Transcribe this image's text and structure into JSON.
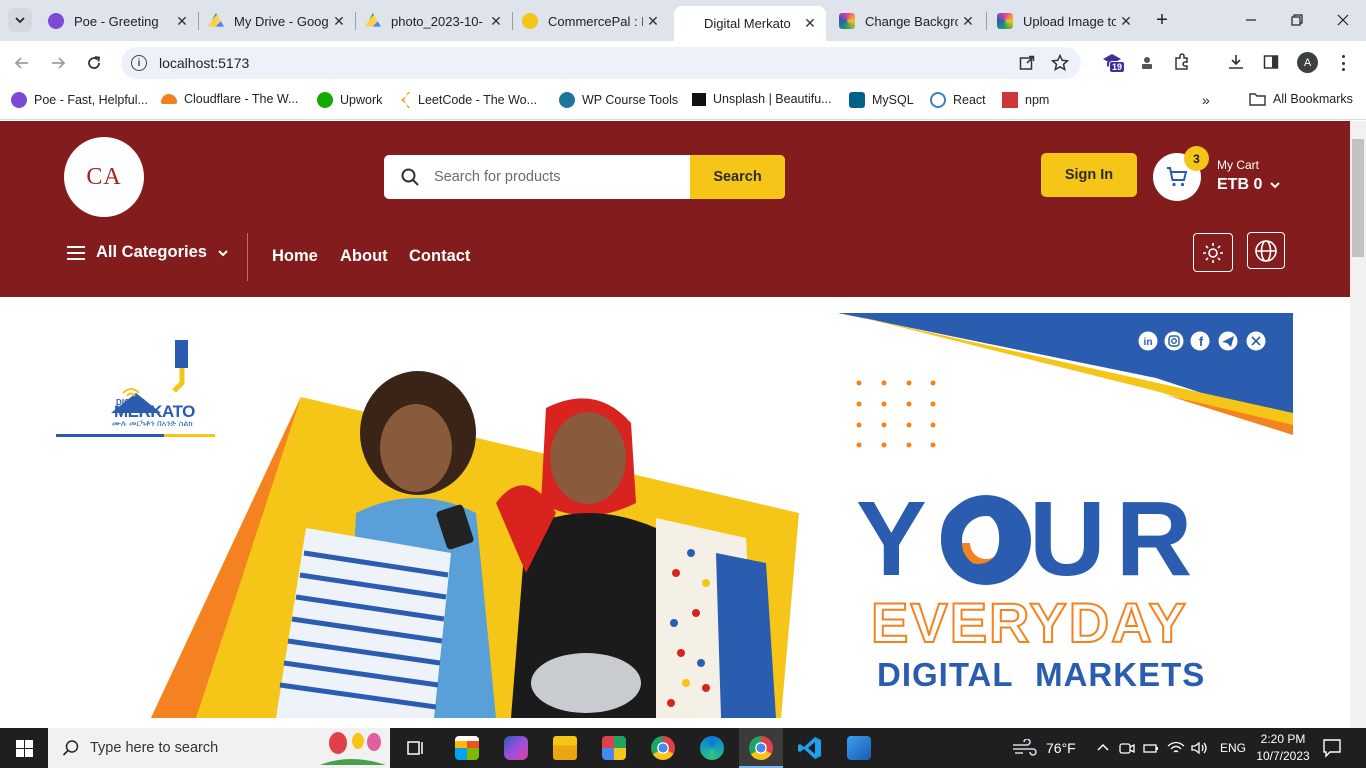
{
  "browser": {
    "tabs": [
      {
        "title": "Poe - Greeting",
        "color": "#7b4bd8"
      },
      {
        "title": "My Drive - Goog",
        "color": "#1fa463"
      },
      {
        "title": "photo_2023-10-",
        "color": "#1fa463"
      },
      {
        "title": "CommercePal : E",
        "color": "#f5c518"
      },
      {
        "title": "Digital Merkato",
        "color": "#ffffff"
      },
      {
        "title": "Change Backgro",
        "color": "#e040a0"
      },
      {
        "title": "Upload Image to",
        "color": "#e040a0"
      }
    ],
    "url": "localhost:5173",
    "extension_badge": "19",
    "profile_initial": "A",
    "bookmarks": [
      {
        "label": "Poe - Fast, Helpful...",
        "color": "#7b4bd8"
      },
      {
        "label": "Cloudflare - The W...",
        "color": "#f38020"
      },
      {
        "label": "Upwork",
        "color": "#14a800"
      },
      {
        "label": "LeetCode - The Wo...",
        "color": "#f89f1b"
      },
      {
        "label": "WP Course Tools",
        "color": "#21759b"
      },
      {
        "label": "Unsplash | Beautifu...",
        "color": "#111111"
      },
      {
        "label": "MySQL",
        "color": "#00618a"
      },
      {
        "label": "React",
        "color": "#3b7fc4"
      },
      {
        "label": "npm",
        "color": "#cb3837"
      }
    ],
    "all_bookmarks": "All Bookmarks"
  },
  "site": {
    "logo_text": "CA",
    "search_placeholder": "Search for products",
    "search_button": "Search",
    "sign_in": "Sign In",
    "cart_count": "3",
    "cart_label": "My Cart",
    "cart_total": "ETB 0",
    "categories_label": "All Categories",
    "nav": [
      "Home",
      "About",
      "Contact"
    ],
    "colors": {
      "header": "#831c1c",
      "accent": "#f5c518",
      "brand_blue": "#2a5db0",
      "brand_orange": "#f58220"
    }
  },
  "banner": {
    "brand_small": "DIGITAL",
    "brand_big": "MERKATO",
    "brand_tagline": "ሙሉ መርካቶን በአንድ ስልክ",
    "headline_1": "YOUR",
    "headline_2": "EVERYDAY",
    "headline_3": "DIGITAL MARKETS",
    "social": [
      "linkedin-icon",
      "instagram-icon",
      "facebook-icon",
      "telegram-icon",
      "x-icon"
    ]
  },
  "taskbar": {
    "search_placeholder": "Type here to search",
    "weather": "76°F",
    "lang": "ENG",
    "time": "2:20 PM",
    "date": "10/7/2023"
  }
}
